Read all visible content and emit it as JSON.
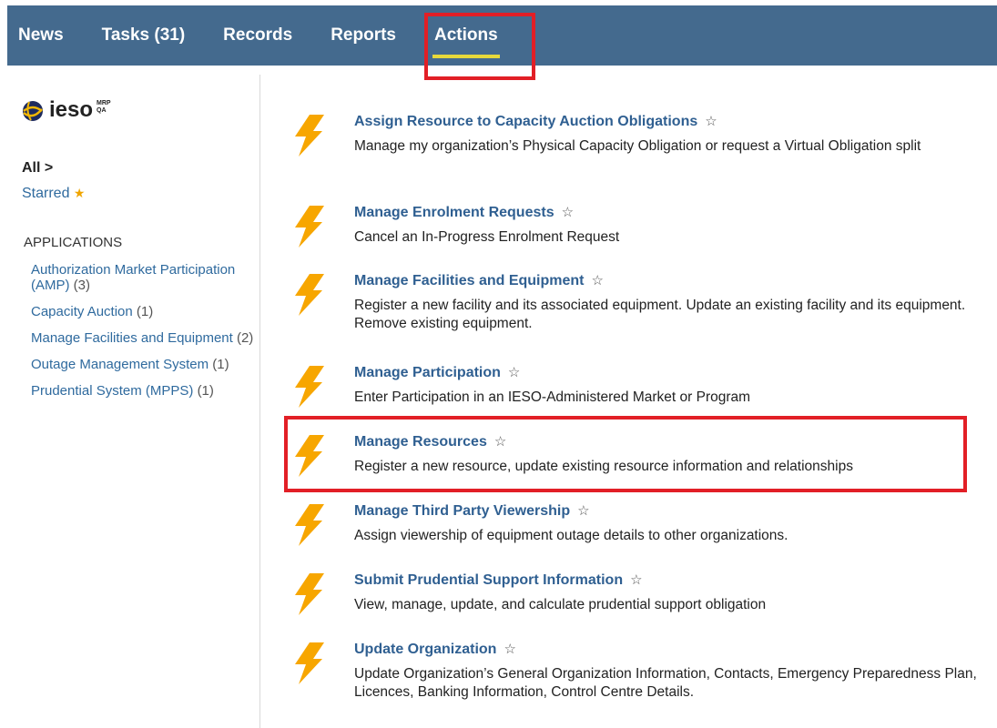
{
  "nav": {
    "tabs": [
      {
        "label": "News"
      },
      {
        "label": "Tasks (31)"
      },
      {
        "label": "Records"
      },
      {
        "label": "Reports"
      },
      {
        "label": "Actions"
      }
    ]
  },
  "logo": {
    "text": "ieso",
    "badge_line1": "MRP",
    "badge_line2": "QA"
  },
  "sidebar": {
    "all_label": "All >",
    "starred_label": "Starred",
    "section_heading": "APPLICATIONS",
    "apps": [
      {
        "label": "Authorization Market Participation (AMP)",
        "count": "(3)"
      },
      {
        "label": "Capacity Auction",
        "count": "(1)"
      },
      {
        "label": "Manage Facilities and Equipment",
        "count": "(2)"
      },
      {
        "label": "Outage Management System",
        "count": "(1)"
      },
      {
        "label": "Prudential System (MPPS)",
        "count": "(1)"
      }
    ]
  },
  "actions": [
    {
      "title": "Assign Resource to Capacity Auction Obligations",
      "desc": "Manage my organization’s Physical Capacity Obligation or request a Virtual Obligation split"
    },
    {
      "title": "Manage Enrolment Requests",
      "desc": "Cancel an In-Progress Enrolment Request"
    },
    {
      "title": "Manage Facilities and Equipment",
      "desc": "Register a new facility and its associated equipment. Update an existing facility and its equipment. Remove existing equipment."
    },
    {
      "title": "Manage Participation",
      "desc": "Enter Participation in an IESO-Administered Market or Program"
    },
    {
      "title": "Manage Resources",
      "desc": "Register a new resource, update existing resource information and relationships"
    },
    {
      "title": "Manage Third Party Viewership",
      "desc": "Assign viewership of equipment outage details to other organizations."
    },
    {
      "title": "Submit Prudential Support Information",
      "desc": "View, manage, update, and calculate prudential support obligation"
    },
    {
      "title": "Update Organization",
      "desc": "Update Organization’s General Organization Information, Contacts, Emergency Preparedness Plan, Licences, Banking Information, Control Centre Details."
    }
  ],
  "colors": {
    "nav_bg": "#446a8e",
    "accent_underline": "#e7d93b",
    "highlight_box": "#e21f26",
    "bolt": "#f7a600",
    "link": "#2f5f91"
  }
}
